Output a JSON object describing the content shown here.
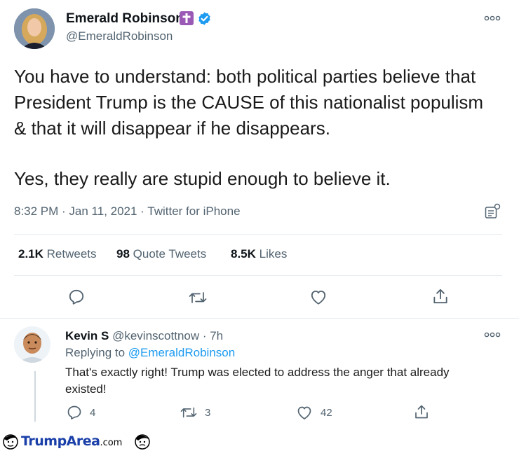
{
  "tweet": {
    "author_name": "Emerald Robinson",
    "author_handle": "@EmeraldRobinson",
    "paragraph1": "You have to understand: both political parties believe that President Trump is the CAUSE of this nationalist populism & that it will disappear if he disappears.",
    "paragraph2": "Yes, they really are stupid enough to believe it.",
    "meta": "8:32 PM · Jan 11, 2021 · Twitter for iPhone",
    "stats": {
      "retweets_count": "2.1K",
      "retweets_label": "Retweets",
      "quotes_count": "98",
      "quotes_label": "Quote Tweets",
      "likes_count": "8.5K",
      "likes_label": "Likes"
    }
  },
  "reply": {
    "author_name": "Kevin S",
    "author_handle_time": "@kevinscottnow · 7h",
    "replying_prefix": "Replying to",
    "replying_handle": "@EmeraldRobinson",
    "text": "That's exactly right! Trump was elected to address the anger that already existed!",
    "reply_count": "4",
    "retweet_count": "3",
    "like_count": "42"
  },
  "watermark": {
    "text": "TrumpArea",
    "suffix": ".com"
  },
  "icons": {
    "verified": "verified-badge-icon",
    "cross_emoji": "latin-cross-icon",
    "more": "more-icon",
    "analytics": "analytics-icon",
    "reply": "reply-icon",
    "retweet": "retweet-icon",
    "like": "like-icon",
    "share": "share-icon"
  },
  "colors": {
    "accent": "#1d9bf0",
    "text": "#0f1419",
    "muted": "#536471",
    "divider": "#e6ecf0",
    "watermark": "#1a3fa8"
  }
}
